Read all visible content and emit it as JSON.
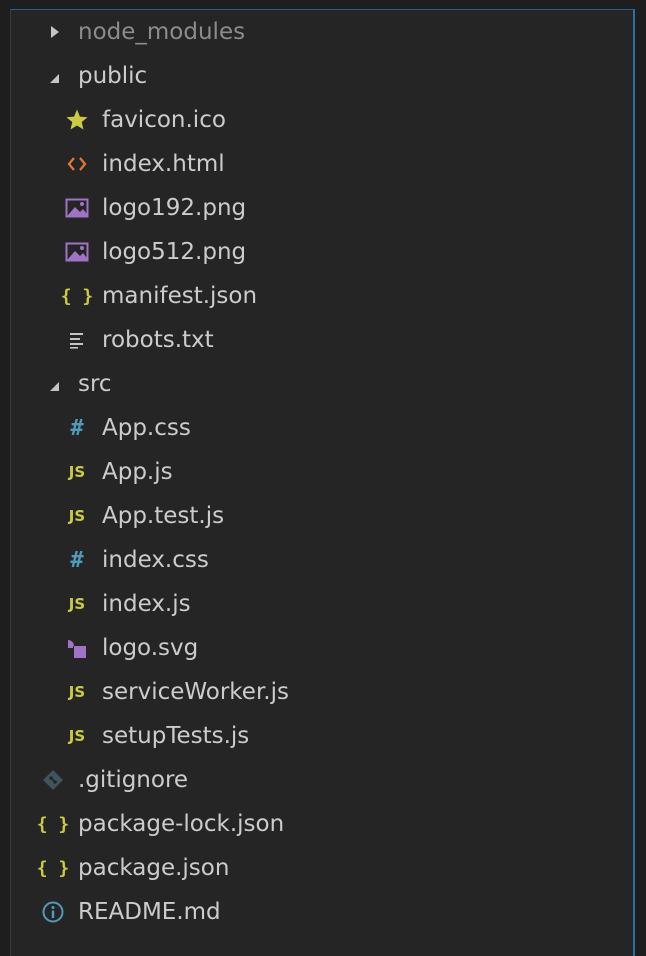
{
  "explorer": {
    "items": [
      {
        "label": "node_modules",
        "icon": "chevron-right-icon",
        "level": 0
      },
      {
        "label": "public",
        "icon": "chevron-down-icon",
        "level": 0
      },
      {
        "label": "favicon.ico",
        "icon": "star-icon",
        "level": 1
      },
      {
        "label": "index.html",
        "icon": "html-code-icon",
        "level": 1
      },
      {
        "label": "logo192.png",
        "icon": "image-icon",
        "level": 1
      },
      {
        "label": "logo512.png",
        "icon": "image-icon",
        "level": 1
      },
      {
        "label": "manifest.json",
        "icon": "json-braces-icon",
        "level": 1
      },
      {
        "label": "robots.txt",
        "icon": "text-lines-icon",
        "level": 1
      },
      {
        "label": "src",
        "icon": "chevron-down-icon",
        "level": 0
      },
      {
        "label": "App.css",
        "icon": "css-hash-icon",
        "level": 1
      },
      {
        "label": "App.js",
        "icon": "javascript-icon",
        "level": 1
      },
      {
        "label": "App.test.js",
        "icon": "javascript-icon",
        "level": 1
      },
      {
        "label": "index.css",
        "icon": "css-hash-icon",
        "level": 1
      },
      {
        "label": "index.js",
        "icon": "javascript-icon",
        "level": 1
      },
      {
        "label": "logo.svg",
        "icon": "svg-shapes-icon",
        "level": 1
      },
      {
        "label": "serviceWorker.js",
        "icon": "javascript-icon",
        "level": 1
      },
      {
        "label": "setupTests.js",
        "icon": "javascript-icon",
        "level": 1
      },
      {
        "label": ".gitignore",
        "icon": "git-diamond-icon",
        "level": 0
      },
      {
        "label": "package-lock.json",
        "icon": "json-braces-icon",
        "level": 0
      },
      {
        "label": "package.json",
        "icon": "json-braces-icon",
        "level": 0
      },
      {
        "label": "README.md",
        "icon": "info-icon",
        "level": 0
      }
    ],
    "glyphs": {
      "javascript": "JS",
      "css": "#",
      "json": "{ }",
      "html": "<>"
    },
    "colors": {
      "background": "#252526",
      "text": "#cccccc",
      "dim_text": "#8c8c8c",
      "javascript": "#cbcb41",
      "css": "#519aba",
      "html": "#e37933",
      "image": "#a074c4",
      "favicon": "#cbcb41",
      "git": "#41535b",
      "info": "#519aba"
    }
  }
}
